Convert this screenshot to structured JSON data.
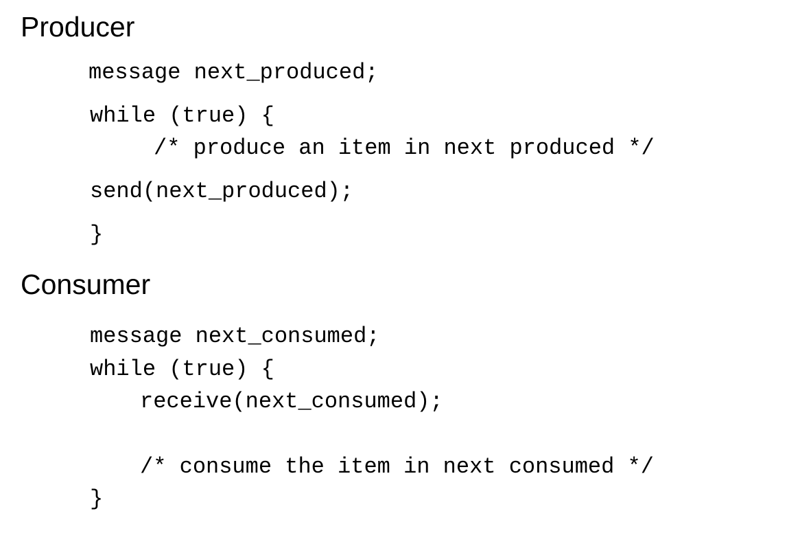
{
  "producer": {
    "title": "Producer",
    "lines": [
      "message next_produced;",
      "while (true) {",
      "/* produce an item in next produced */",
      "send(next_produced);",
      "}"
    ]
  },
  "consumer": {
    "title": "Consumer",
    "lines": [
      "message next_consumed;",
      "while (true) {",
      "receive(next_consumed);",
      "/* consume the item in next consumed */",
      "}"
    ]
  }
}
